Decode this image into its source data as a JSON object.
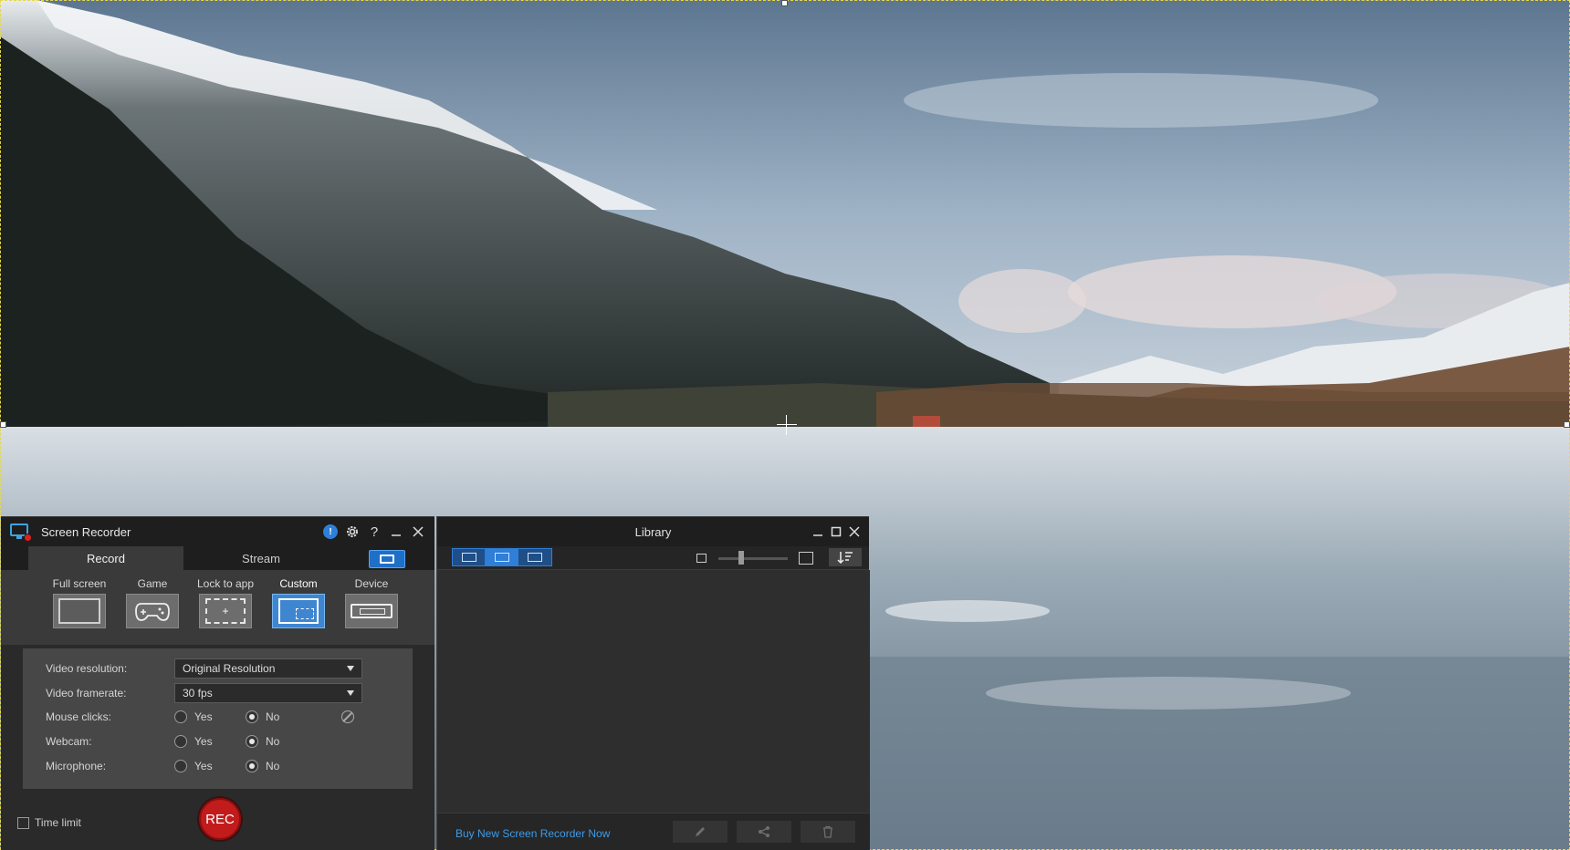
{
  "recorder": {
    "title": "Screen Recorder",
    "notification_badge": "!",
    "titlebar_icons": [
      "gear-icon",
      "help-icon",
      "minimize-icon",
      "close-icon"
    ],
    "help_label": "?",
    "tabs": [
      {
        "label": "Record",
        "active": true
      },
      {
        "label": "Stream",
        "active": false
      }
    ],
    "modes": [
      {
        "label": "Full screen",
        "icon": "full-screen-icon",
        "active": false
      },
      {
        "label": "Game",
        "icon": "gamepad-icon",
        "active": false
      },
      {
        "label": "Lock to app",
        "icon": "lock-to-app-icon",
        "active": false
      },
      {
        "label": "Custom",
        "icon": "custom-region-icon",
        "active": true
      },
      {
        "label": "Device",
        "icon": "device-icon",
        "active": false
      }
    ],
    "settings": {
      "video_resolution": {
        "label": "Video resolution:",
        "value": "Original Resolution"
      },
      "video_framerate": {
        "label": "Video framerate:",
        "value": "30 fps"
      },
      "mouse_clicks": {
        "label": "Mouse clicks:",
        "yes": "Yes",
        "no": "No",
        "selected": "No"
      },
      "webcam": {
        "label": "Webcam:",
        "yes": "Yes",
        "no": "No",
        "selected": "No"
      },
      "microphone": {
        "label": "Microphone:",
        "yes": "Yes",
        "no": "No",
        "selected": "No"
      }
    },
    "time_limit": {
      "label": "Time limit",
      "checked": false
    },
    "rec_label": "REC"
  },
  "library": {
    "title": "Library",
    "view_modes": [
      "capture-view-icon",
      "video-view-icon",
      "image-view-icon"
    ],
    "selected_view": 1,
    "buy_link": "Buy New Screen Recorder Now",
    "actions": [
      "edit-icon",
      "share-icon",
      "delete-icon"
    ]
  },
  "colors": {
    "accent": "#2f7ed8",
    "rec_red": "#c21b1b",
    "window_bg": "#2a2a2a",
    "panel_bg": "#474747",
    "link": "#3d9be9"
  }
}
